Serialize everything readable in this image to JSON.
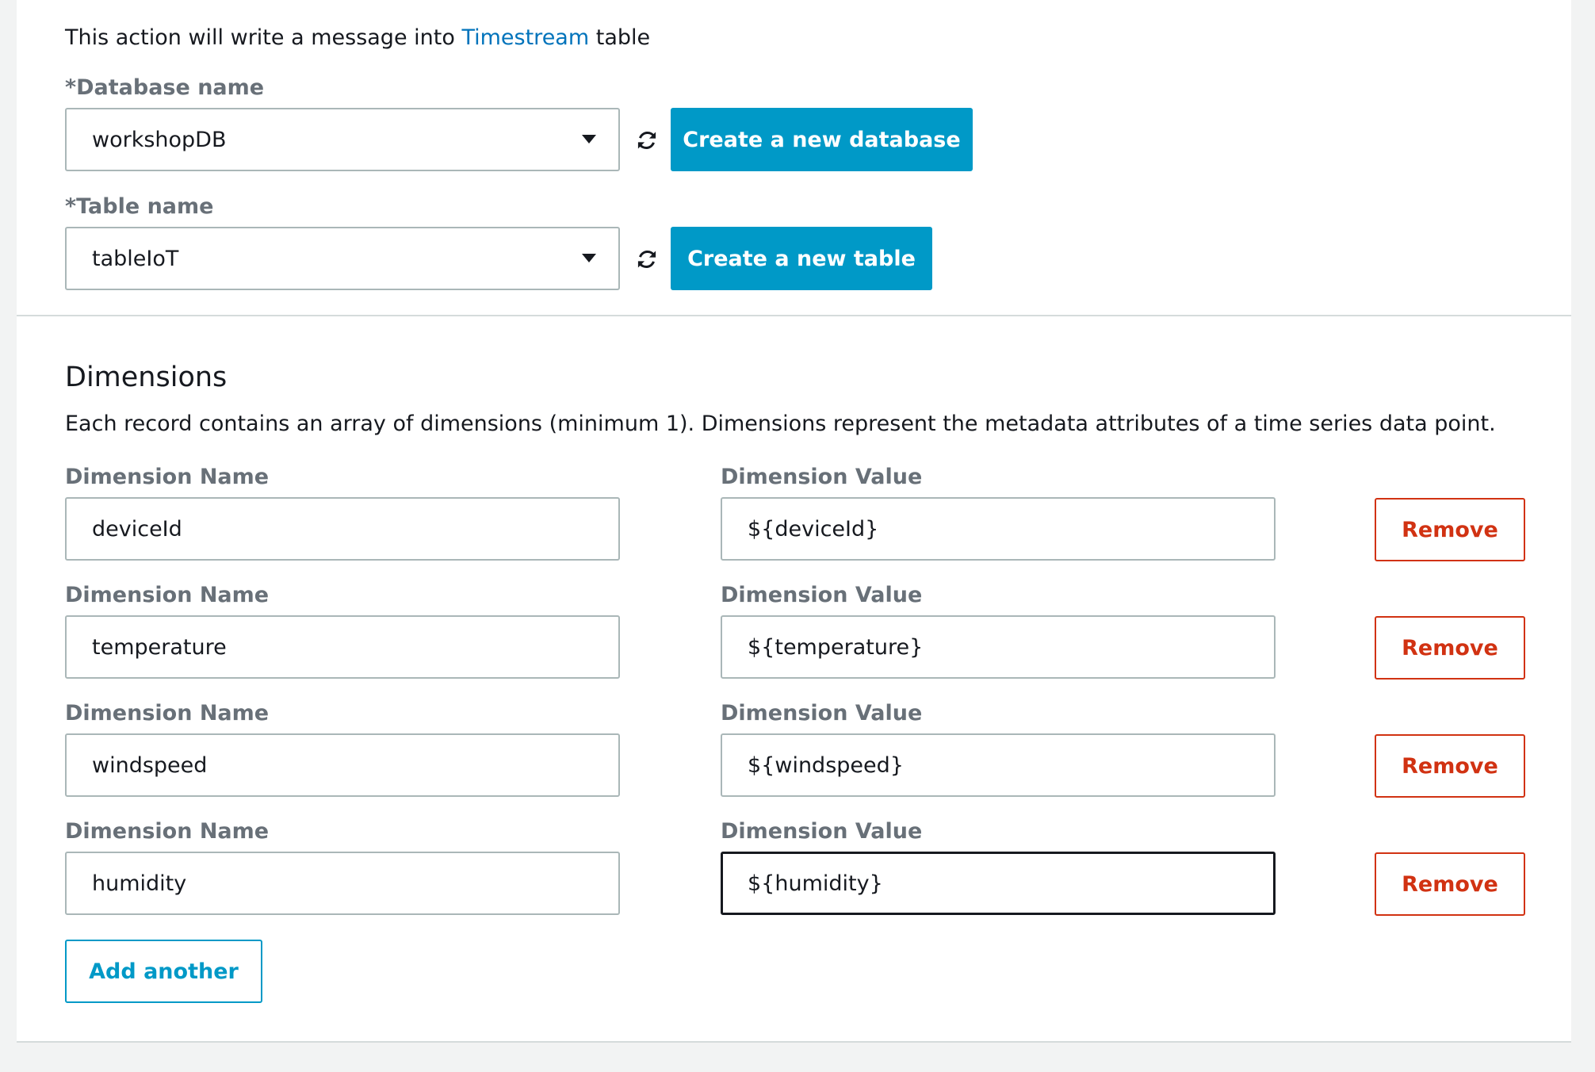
{
  "intro": {
    "prefix": "This action will write a message into",
    "link": "Timestream",
    "suffix": "table"
  },
  "database": {
    "label": "*Database name",
    "value": "workshopDB",
    "create_label": "Create a new database"
  },
  "table": {
    "label": "*Table name",
    "value": "tableIoT",
    "create_label": "Create a new table"
  },
  "dimensions": {
    "title": "Dimensions",
    "description": "Each record contains an array of dimensions (minimum 1). Dimensions represent the metadata attributes of a time series data point.",
    "name_label": "Dimension Name",
    "value_label": "Dimension Value",
    "remove_label": "Remove",
    "rows": [
      {
        "name": "deviceId",
        "value": "${deviceId}"
      },
      {
        "name": "temperature",
        "value": "${temperature}"
      },
      {
        "name": "windspeed",
        "value": "${windspeed}"
      },
      {
        "name": "humidity",
        "value": "${humidity}"
      }
    ],
    "add_label": "Add another"
  },
  "colors": {
    "primary": "#0099c7",
    "danger": "#d13212",
    "link": "#0073bb"
  },
  "icons": {
    "refresh": "refresh-icon",
    "dropdown": "caret-down-icon"
  }
}
